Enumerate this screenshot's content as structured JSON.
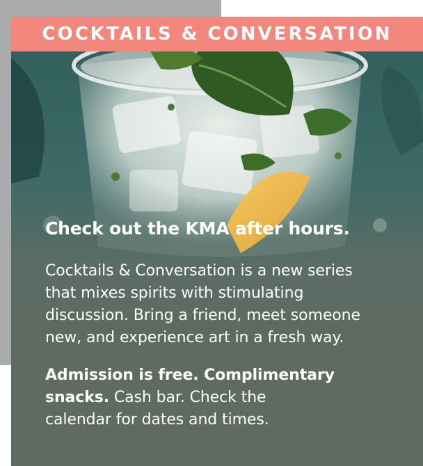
{
  "banner": {
    "title": "COCKTAILS & CONVERSATION"
  },
  "headline": "Check out the KMA after hours.",
  "description": {
    "lines": [
      "Cocktails & Conversation is a new series",
      "that mixes spirits with stimulating",
      "discussion. Bring a friend, meet someone",
      "new, and experience art in a fresh way."
    ]
  },
  "admission": {
    "line1_bold": "Admission is free. Complimentary",
    "line2_bold": "snacks.",
    "line2_rest": " Cash bar. Check the",
    "line3": "calendar for dates and times."
  },
  "colors": {
    "banner": "#f2877e",
    "panel": "#5e6a62",
    "backdrop": "#a9abad",
    "text": "#ffffff"
  },
  "image": {
    "subject": "cocktail-glass-photo"
  }
}
